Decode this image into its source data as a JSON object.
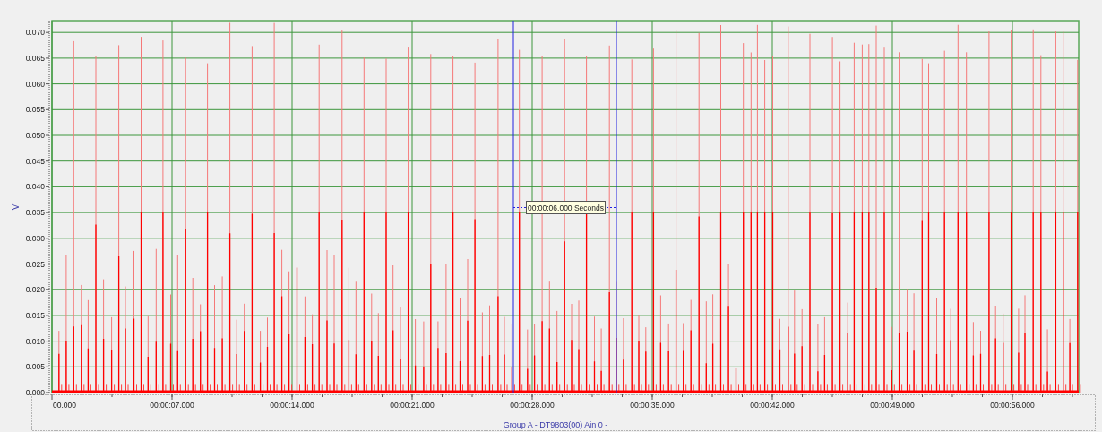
{
  "chart": {
    "y_axis_label": "V",
    "y_ticks": [
      "0.070",
      "0.065",
      "0.060",
      "0.055",
      "0.050",
      "0.045",
      "0.040",
      "0.035",
      "0.030",
      "0.025",
      "0.020",
      "0.015",
      "0.010",
      "0.005",
      "0.000"
    ],
    "x_ticks": [
      "00.000",
      "00:00:07.000",
      "00:00:14.000",
      "00:00:21.000",
      "00:00:28.000",
      "00:00:35.000",
      "00:00:42.000",
      "00:00:49.000",
      "00:00:56.000"
    ],
    "cursor_readout": "00:00:06.000 Seconds",
    "legend": "Group A - DT9803(00) Ain 0 -"
  }
}
